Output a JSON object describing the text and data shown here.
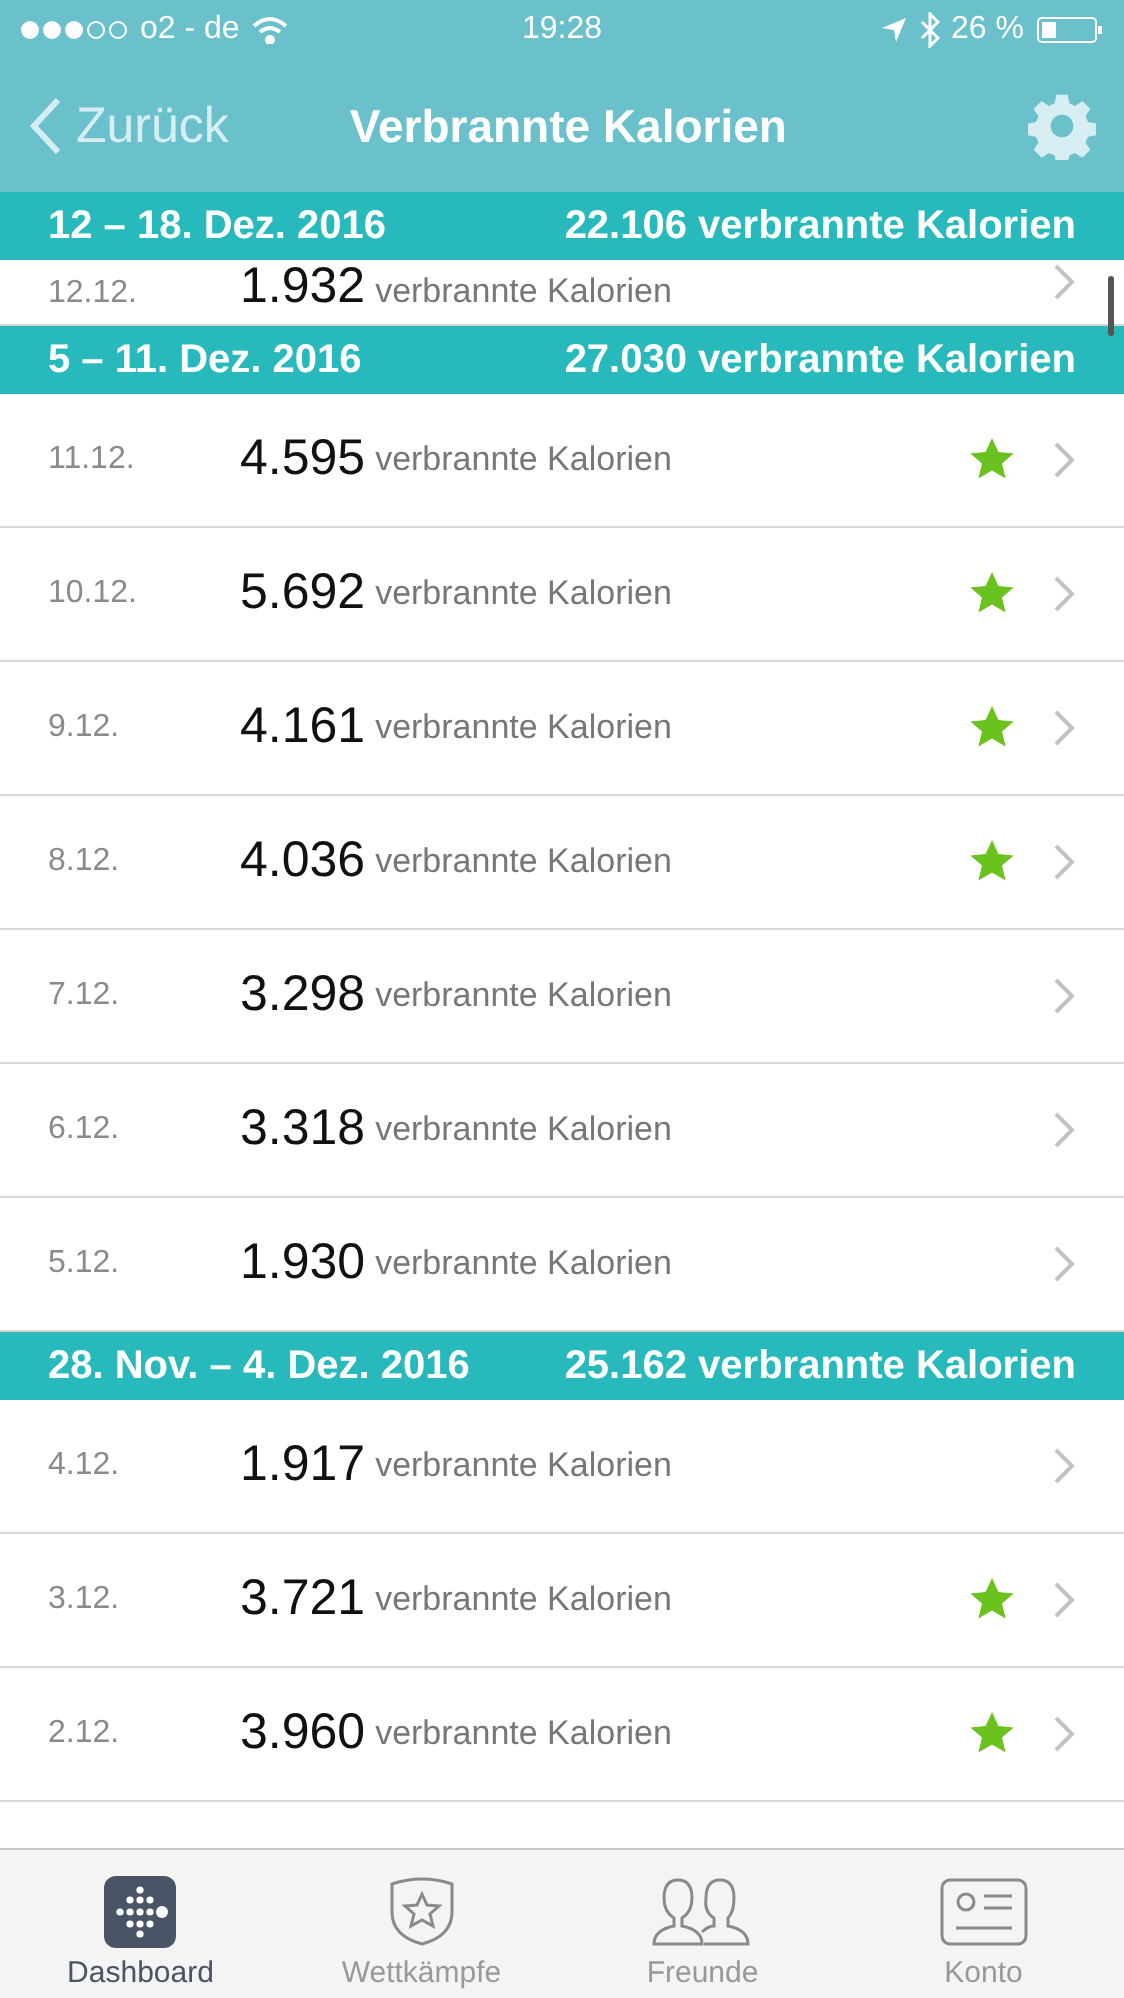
{
  "status_bar": {
    "carrier": "o2 - de",
    "time": "19:28",
    "battery": "26 %"
  },
  "nav": {
    "back": "Zurück",
    "title": "Verbrannte Kalorien"
  },
  "weeks": [
    {
      "range": "12 – 18. Dez. 2016",
      "total": "22.106 verbrannte Kalorien",
      "partial": true,
      "days": [
        {
          "date": "12.12.",
          "value": "1.932",
          "unit": "verbrannte Kalorien",
          "starred": false
        }
      ]
    },
    {
      "range": "5 – 11. Dez. 2016",
      "total": "27.030 verbrannte Kalorien",
      "partial": false,
      "days": [
        {
          "date": "11.12.",
          "value": "4.595",
          "unit": "verbrannte Kalorien",
          "starred": true
        },
        {
          "date": "10.12.",
          "value": "5.692",
          "unit": "verbrannte Kalorien",
          "starred": true
        },
        {
          "date": "9.12.",
          "value": "4.161",
          "unit": "verbrannte Kalorien",
          "starred": true
        },
        {
          "date": "8.12.",
          "value": "4.036",
          "unit": "verbrannte Kalorien",
          "starred": true
        },
        {
          "date": "7.12.",
          "value": "3.298",
          "unit": "verbrannte Kalorien",
          "starred": false
        },
        {
          "date": "6.12.",
          "value": "3.318",
          "unit": "verbrannte Kalorien",
          "starred": false
        },
        {
          "date": "5.12.",
          "value": "1.930",
          "unit": "verbrannte Kalorien",
          "starred": false
        }
      ]
    },
    {
      "range": "28. Nov. – 4. Dez. 2016",
      "total": "25.162 verbrannte Kalorien",
      "partial": false,
      "days": [
        {
          "date": "4.12.",
          "value": "1.917",
          "unit": "verbrannte Kalorien",
          "starred": false
        },
        {
          "date": "3.12.",
          "value": "3.721",
          "unit": "verbrannte Kalorien",
          "starred": true
        },
        {
          "date": "2.12.",
          "value": "3.960",
          "unit": "verbrannte Kalorien",
          "starred": true
        }
      ]
    }
  ],
  "tabs": [
    {
      "kind": "dashboard",
      "label": "Dashboard",
      "selected": true
    },
    {
      "kind": "challenges",
      "label": "Wettkämpfe",
      "selected": false
    },
    {
      "kind": "friends",
      "label": "Freunde",
      "selected": false
    },
    {
      "kind": "account",
      "label": "Konto",
      "selected": false
    }
  ]
}
